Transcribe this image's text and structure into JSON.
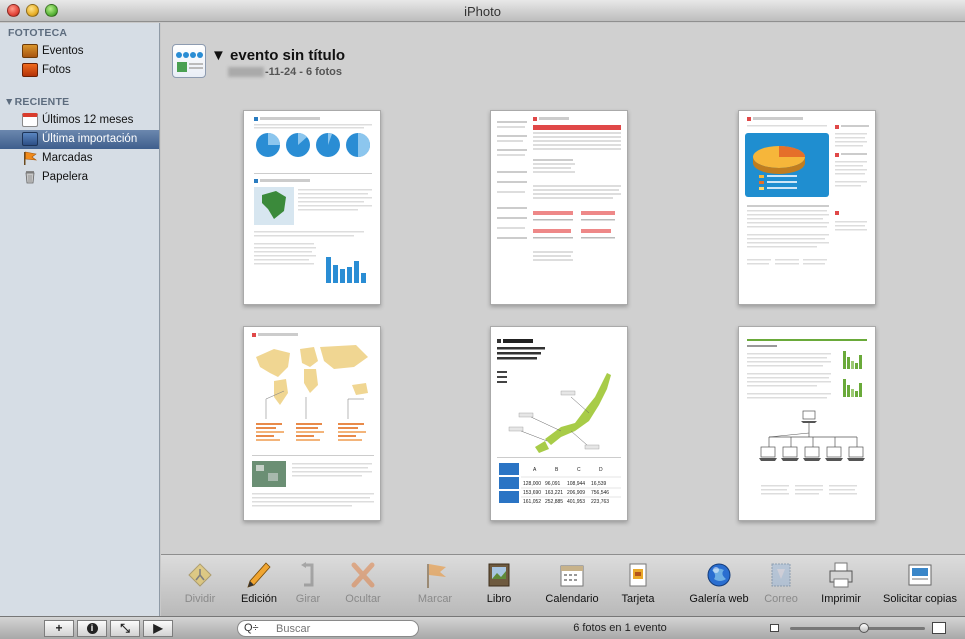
{
  "window": {
    "title": "iPhoto"
  },
  "sidebar": {
    "sections": [
      {
        "label": "FOTOTECA"
      },
      {
        "label": "▼RECIENTE"
      }
    ],
    "items": [
      {
        "label": "Eventos",
        "icon": "events-icon"
      },
      {
        "label": "Fotos",
        "icon": "photos-icon"
      },
      {
        "label": "Últimos 12 meses",
        "icon": "calendar-icon"
      },
      {
        "label": "Última importación",
        "icon": "import-icon",
        "selected": true
      },
      {
        "label": "Marcadas",
        "icon": "flag-icon"
      },
      {
        "label": "Papelera",
        "icon": "trash-icon"
      }
    ]
  },
  "event": {
    "title": "evento sin título",
    "subtitle": "-11-24 - 6 fotos"
  },
  "toolbar": {
    "buttons": [
      {
        "label": "Dividir",
        "enabled": false
      },
      {
        "label": "Edición",
        "enabled": true
      },
      {
        "label": "Girar",
        "enabled": false
      },
      {
        "label": "Ocultar",
        "enabled": false
      },
      {
        "label": "Marcar",
        "enabled": false
      },
      {
        "label": "Libro",
        "enabled": true
      },
      {
        "label": "Calendario",
        "enabled": true
      },
      {
        "label": "Tarjeta",
        "enabled": true
      },
      {
        "label": "Galería web",
        "enabled": true
      },
      {
        "label": "Correo",
        "enabled": false
      },
      {
        "label": "Imprimir",
        "enabled": true
      },
      {
        "label": "Solicitar copias",
        "enabled": true
      }
    ]
  },
  "bottombar": {
    "buttons": [
      "+",
      "i",
      "⤡",
      "▶"
    ],
    "search_placeholder": "Buscar",
    "search_filter": "Q÷",
    "status": "6 fotos en 1 evento",
    "zoom": 0.55
  },
  "thumbnails": [
    {
      "kind": "pies-map-bars"
    },
    {
      "kind": "table-report"
    },
    {
      "kind": "pie-3d"
    },
    {
      "kind": "world-map"
    },
    {
      "kind": "japan-map"
    },
    {
      "kind": "network"
    }
  ],
  "japan_table": {
    "headers": [
      "A",
      "B",
      "C",
      "D"
    ],
    "rows": [
      [
        "128,000",
        "96,091",
        "108,944",
        "16,539"
      ],
      [
        "153,690",
        "163,221",
        "206,909",
        "756,546"
      ],
      [
        "161,052",
        "252,885",
        "401,953",
        "223,763"
      ]
    ]
  },
  "colors": {
    "selection": "#4c6b98",
    "accent_blue": "#2a8dd4",
    "accent_red": "#e04848",
    "accent_green": "#6aaa3a"
  }
}
